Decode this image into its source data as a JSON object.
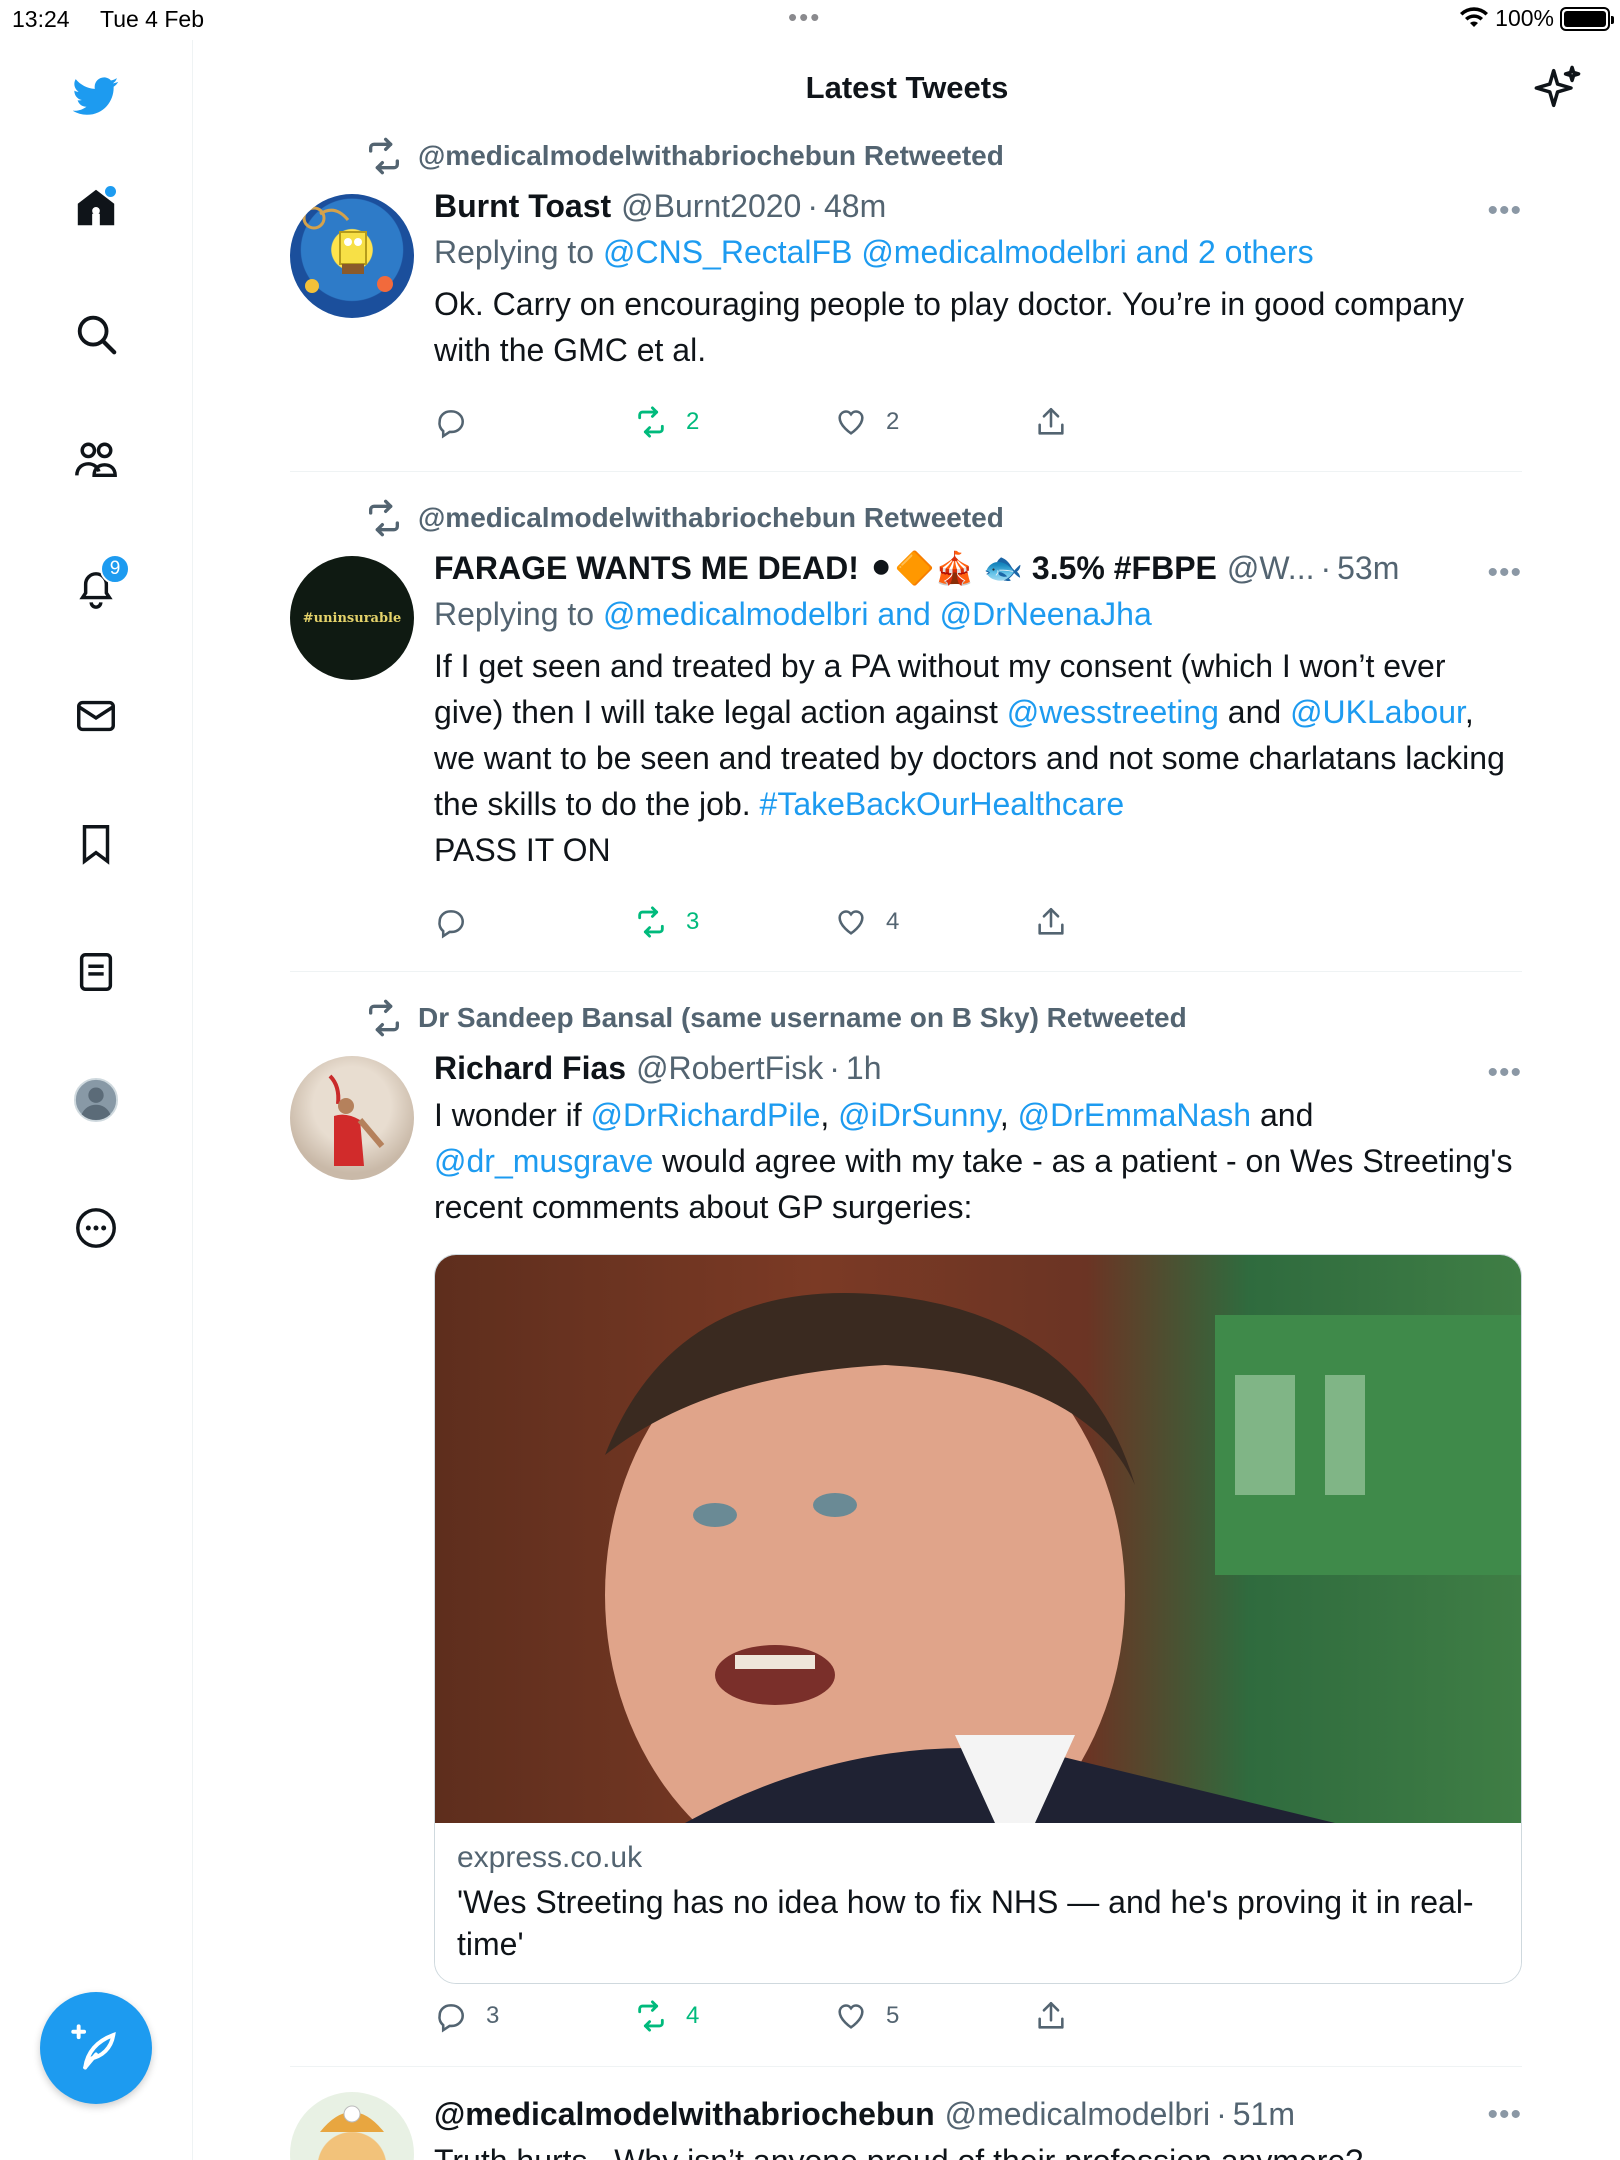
{
  "status_bar": {
    "time": "13:24",
    "date": "Tue 4 Feb",
    "battery": "100%"
  },
  "header": {
    "title": "Latest Tweets"
  },
  "sidebar": {
    "notifications_badge": "9",
    "items": [
      "home",
      "search",
      "communities",
      "notifications",
      "messages",
      "bookmarks",
      "lists",
      "profile",
      "more"
    ]
  },
  "tweets": [
    {
      "retweeted_by": "@medicalmodelwithabriochebun Retweeted",
      "name": "Burnt Toast",
      "handle": "@Burnt2020",
      "age": "48m",
      "replying_prefix": "Replying to ",
      "replying_links": "@CNS_RectalFB @medicalmodelbri and 2 others",
      "text": "Ok. Carry on encouraging people to play doctor. You’re in good company with the GMC et al.",
      "replies": "",
      "retweets": "2",
      "likes": "2"
    },
    {
      "retweeted_by": "@medicalmodelwithabriochebun Retweeted",
      "name": "FARAGE WANTS ME DEAD! ⚫🔶🎪 🐟 3.5% #FBPE",
      "handle": "@W...",
      "age": "53m",
      "avatar_text": "#uninsurable",
      "replying_prefix": "Replying to ",
      "replying_links": "@medicalmodelbri and @DrNeenaJha",
      "text_1": "If I get seen and treated by a PA without my consent (which I won’t ever give) then I will take legal action against ",
      "mention_1": "@wesstreeting",
      "text_2": " and ",
      "mention_2": "@UKLabour",
      "text_3": ", we want to be seen and treated by doctors and not some charlatans lacking the skills to do the job. ",
      "hashtag": "#TakeBackOurHealthcare",
      "text_4": "PASS IT ON",
      "replies": "",
      "retweets": "3",
      "likes": "4"
    },
    {
      "retweeted_by": "Dr Sandeep Bansal (same username on B Sky) Retweeted",
      "name": "Richard Fias",
      "handle": "@RobertFisk",
      "age": "1h",
      "text_1": "I wonder if ",
      "mention_1": "@DrRichardPile",
      "comma_1": ", ",
      "mention_2": "@iDrSunny",
      "comma_2": ", ",
      "mention_3": "@DrEmmaNash",
      "and": " and ",
      "mention_4": "@dr_musgrave",
      "text_2": " would agree with my take - as a patient - on Wes Streeting's recent comments about GP surgeries:",
      "card_domain": "express.co.uk",
      "card_title": "'Wes Streeting has no idea how to fix NHS — and he's proving it in real-time'",
      "replies": "3",
      "retweets": "4",
      "likes": "5"
    },
    {
      "name": "@medicalmodelwithabriochebun",
      "handle": "@medicalmodelbri",
      "age": "51m",
      "text": "Truth hurts . Why isn’t anyone proud of their profession anymore?"
    }
  ],
  "colors": {
    "accent": "#1d9bf0",
    "retweet_green": "#00ba7c",
    "muted": "#536471"
  },
  "icons": [
    "twitter-bird-icon",
    "home-icon",
    "search-icon",
    "communities-icon",
    "bell-icon",
    "mail-icon",
    "bookmark-icon",
    "list-icon",
    "profile-icon",
    "more-circle-icon",
    "sparkle-icon",
    "retweet-icon",
    "reply-icon",
    "like-icon",
    "share-icon",
    "compose-icon"
  ]
}
